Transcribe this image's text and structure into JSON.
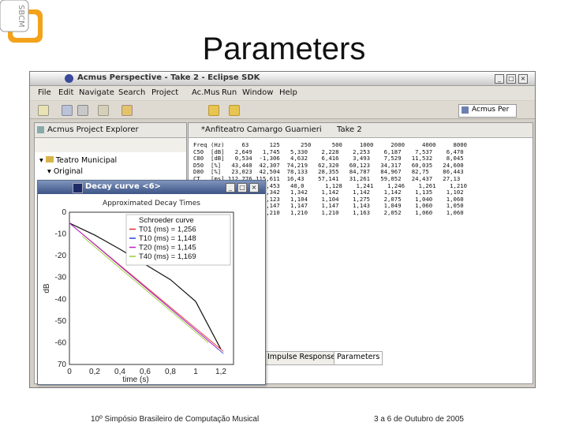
{
  "slide": {
    "title": "Parameters",
    "footer_left": "10º Simpósio Brasileiro de Computação Musical",
    "footer_right": "3 a 6 de Outubro de 2005"
  },
  "logo": {
    "letters": "SBCM"
  },
  "eclipse": {
    "window_title": "Acmus Perspective - Take 2 - Eclipse SDK",
    "menu": [
      "File",
      "Edit",
      "Navigate",
      "Search",
      "Project",
      "Ac.Mus",
      "Run",
      "Window",
      "Help"
    ],
    "perspective_label": "Acmus Per",
    "explorer": {
      "tab": "Acmus Project Explorer",
      "items": [
        "Teatro Municipal",
        "Original"
      ]
    },
    "editor": {
      "tabs": [
        "*Anfiteatro Camargo Guarnieri",
        "Take 2"
      ],
      "bottom_tabs": [
        "Impulse Response",
        "Parameters"
      ],
      "table_rows": [
        "Freq (Hz)     63      125      250      500     1000     2000     4000     8000",
        "C50  [dB]   2,649   1,745   5,330    2,228    2,253    6,187    7,537    6,470",
        "C80  [dB]   0,534  -1,306   4,632    6,416    3,493    7,529   11,532    8,045",
        "D50  [%]   43,440  42,307  74,219   62,320   60,123   34,317   60,035   24,600",
        "D80  [%]   23,023  42,504  78,133   28,355   84,787   84,967   82,75    86,443",
        "CT   [ms] 112,776 115,611  16,43    57,141   31,261   59,052   24,437   27,13",
        "            1,481   1,453   40,0      1,128    1,241    1,246    1,261    1,210",
        "            1,242   1,342   1,342    1,142    1,142    1,142    1,135    1,102",
        "            1,220   2,123   1,104    1,104    1,275    2,075    1,040    1,060",
        "            1,200   1,147   1,147    1,147    1,143    1,049    1,060    1,050",
        "            1,063   1,210   1,210    1,210    1,163    2,052    1,060    1,060"
      ]
    }
  },
  "dialog": {
    "title": "Decay curve <6>",
    "subtitle": "Approximated Decay Times",
    "ylabel": "dB",
    "xlabel": "time (s)",
    "legend": [
      "Schroeder curve",
      "T01 (ms) = 1,256",
      "T10 (ms) = 1,148",
      "T20 (ms) = 1,145",
      "T40 (ms) = 1,169"
    ],
    "colors": {
      "schroeder": "#111111",
      "t01": "#e23030",
      "t10": "#2b44e0",
      "t20": "#c020c0",
      "t40": "#9acd32"
    }
  },
  "chart_data": {
    "type": "line",
    "title": "Approximated Decay Times",
    "xlabel": "time (s)",
    "ylabel": "dB",
    "xlim": [
      0,
      1.3
    ],
    "ylim": [
      -70,
      0
    ],
    "xticks": [
      "0",
      "0,2",
      "0,4",
      "0,6",
      "0,8",
      "1",
      "1,2"
    ],
    "yticks": [
      "0",
      "-10",
      "-20",
      "-30",
      "-40",
      "-50",
      "-60",
      "70"
    ],
    "series": [
      {
        "name": "Schroeder curve",
        "x": [
          0,
          0.2,
          0.4,
          0.6,
          0.8,
          1.0,
          1.2
        ],
        "y": [
          -5,
          -10.5,
          -17,
          -24,
          -31,
          -41,
          -63
        ]
      },
      {
        "name": "T01 (ms) = 1,256",
        "x": [
          0,
          1.22
        ],
        "y": [
          -5,
          -64
        ]
      },
      {
        "name": "T10 (ms) = 1,148",
        "x": [
          0,
          1.22
        ],
        "y": [
          -5,
          -65
        ]
      },
      {
        "name": "T20 (ms) = 1,145",
        "x": [
          0,
          1.18
        ],
        "y": [
          -5,
          -63
        ]
      },
      {
        "name": "T40 (ms) = 1,169",
        "x": [
          0.1,
          1.1
        ],
        "y": [
          -11,
          -60
        ]
      }
    ],
    "legend_position": "top-right",
    "grid": false
  }
}
